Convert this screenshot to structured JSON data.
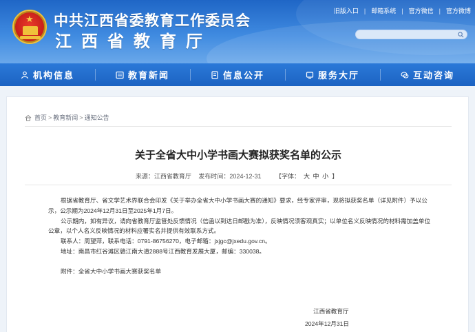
{
  "header": {
    "org_name": "中共江西省委教育工作委员会",
    "dept_name": "江西省教育厅",
    "toplinks": [
      "旧版入口",
      "邮箱系统",
      "官方微信",
      "官方微博"
    ],
    "search": {
      "placeholder": ""
    }
  },
  "nav": {
    "items": [
      {
        "label": "机构信息",
        "icon": "people-icon"
      },
      {
        "label": "教育新闻",
        "icon": "news-icon"
      },
      {
        "label": "信息公开",
        "icon": "document-icon"
      },
      {
        "label": "服务大厅",
        "icon": "service-icon"
      },
      {
        "label": "互动咨询",
        "icon": "chat-icon"
      }
    ]
  },
  "breadcrumb": [
    "首页",
    "教育新闻",
    "通知公告"
  ],
  "article": {
    "title": "关于全省大中小学书画大赛拟获奖名单的公示",
    "source_label": "来源：江西省教育厅",
    "publish_label": "发布时间：2024-12-31",
    "fontsize_label": "【字体：",
    "fontsize_options": [
      "大",
      "中",
      "小"
    ],
    "fontsize_close": "】",
    "paragraphs": [
      "根据省教育厅、省文学艺术界联合会印发《关于举办全省大中小学书画大赛的通知》要求，经专家评审，现将拟获奖名单（详见附件）予以公示，公示期为2024年12月31日至2025年1月7日。",
      "公示期内，如有异议，请向省教育厅监管处反馈情况（信函以到达日邮戳为准），反映情况须客观真实；以单位名义反映情况的材料需加盖单位公章，以个人名义反映情况的材料应署实名并提供有效联系方式。",
      "联系人：周望萍，联系电话：0791-86756270，电子邮箱：jxjgc@jxedu.gov.cn。",
      "地址：南昌市红谷滩区赣江南大道2888号江西教育发展大厦，邮编：330038。"
    ],
    "attachment": "附件：全省大中小学书画大赛获奖名单",
    "signature_org": "江西省教育厅",
    "signature_date": "2024年12月31日"
  },
  "colors": {
    "header_blue": "#1f66c6",
    "nav_blue": "#1c63c2",
    "emblem_red": "#c8201a",
    "emblem_gold": "#f0c23a"
  }
}
